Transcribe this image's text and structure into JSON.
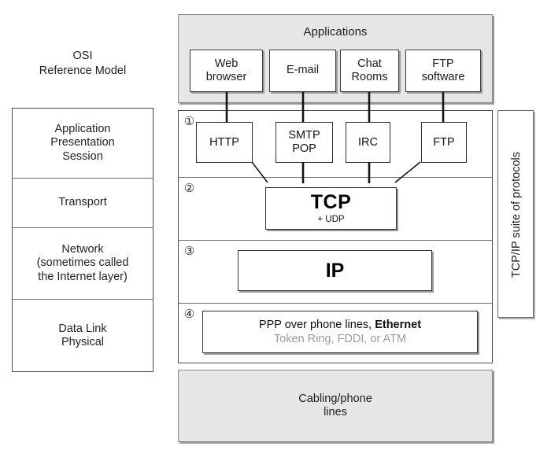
{
  "osi": {
    "title_line_1": "OSI",
    "title_line_2": "Reference Model",
    "rows": [
      {
        "lines": [
          "Application",
          "Presentation",
          "Session"
        ]
      },
      {
        "lines": [
          "Transport"
        ]
      },
      {
        "lines": [
          "Network",
          "(sometimes called",
          "the Internet layer)"
        ]
      },
      {
        "lines": [
          "Data Link",
          "Physical"
        ]
      }
    ]
  },
  "applications": {
    "panel_title": "Applications",
    "boxes": [
      {
        "lines": [
          "Web",
          "browser"
        ]
      },
      {
        "lines": [
          "E-mail"
        ]
      },
      {
        "lines": [
          "Chat",
          "Rooms"
        ]
      },
      {
        "lines": [
          "FTP",
          "software"
        ]
      }
    ]
  },
  "layers": {
    "markers": [
      "①",
      "②",
      "③",
      "④"
    ],
    "protocols": [
      {
        "lines": [
          "HTTP"
        ]
      },
      {
        "lines": [
          "SMTP",
          "POP"
        ]
      },
      {
        "lines": [
          "IRC"
        ]
      },
      {
        "lines": [
          "FTP"
        ]
      }
    ],
    "transport": {
      "main": "TCP",
      "sub": "+ UDP"
    },
    "internet": {
      "main": "IP"
    },
    "link": {
      "line_1_plain": "PPP over phone lines, ",
      "line_1_bold": "Ethernet",
      "line_2": "Token Ring, FDDI, or ATM"
    }
  },
  "suite": {
    "label": "TCP/IP suite of protocols"
  },
  "cabling": {
    "line_1": "Cabling/phone",
    "line_2": "lines"
  },
  "colors": {
    "panel_gray": "#e6e6e6",
    "box_white": "#ffffff",
    "border_dark": "#2e2e2e",
    "muted_text": "#9b9b9b",
    "shadow": "#9a9a9a"
  }
}
